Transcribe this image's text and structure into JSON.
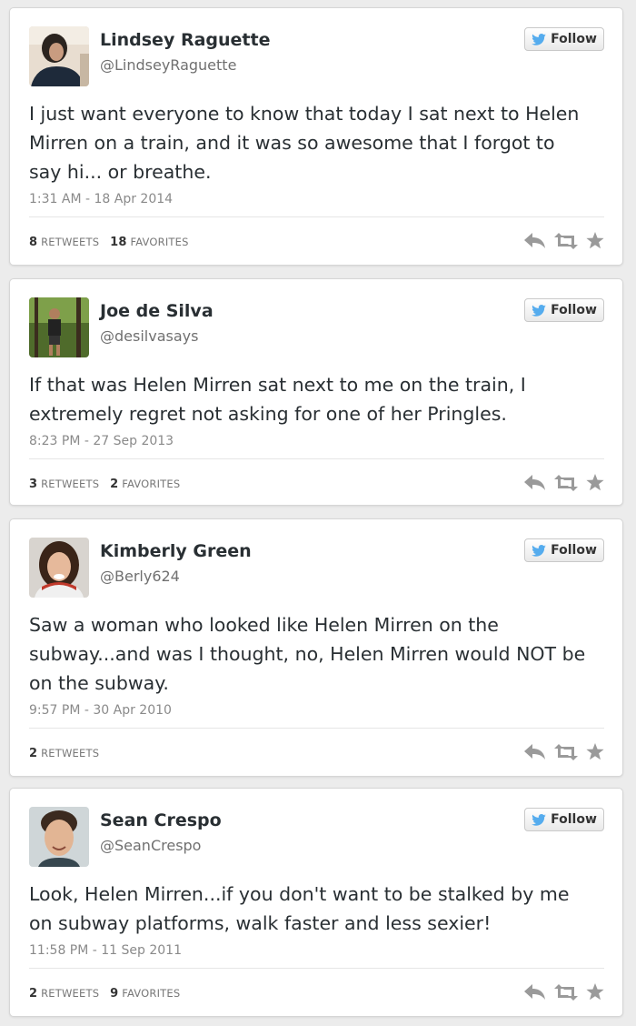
{
  "tweets": [
    {
      "name": "Lindsey Raguette",
      "handle": "@LindseyRaguette",
      "follow_label": "Follow",
      "text": "I just want everyone to know that today I sat next to Helen Mirren on a train, and it was so awesome that I forgot to say hi... or breathe.",
      "timestamp": "1:31 AM - 18 Apr 2014",
      "retweets_count": "8",
      "retweets_label": "RETWEETS",
      "favorites_count": "18",
      "favorites_label": "FAVORITES"
    },
    {
      "name": "Joe de Silva",
      "handle": "@desilvasays",
      "follow_label": "Follow",
      "text": "If that was Helen Mirren sat next to me on the train, I extremely regret not asking for one of her Pringles.",
      "timestamp": "8:23 PM - 27 Sep 2013",
      "retweets_count": "3",
      "retweets_label": "RETWEETS",
      "favorites_count": "2",
      "favorites_label": "FAVORITES"
    },
    {
      "name": "Kimberly Green",
      "handle": "@Berly624",
      "follow_label": "Follow",
      "text": "Saw a woman who looked like Helen Mirren on the subway...and was I thought, no, Helen Mirren would NOT be on the subway.",
      "timestamp": "9:57 PM - 30 Apr 2010",
      "retweets_count": "2",
      "retweets_label": "RETWEETS",
      "favorites_count": "",
      "favorites_label": ""
    },
    {
      "name": "Sean Crespo",
      "handle": "@SeanCrespo",
      "follow_label": "Follow",
      "text": "Look, Helen Mirren...if you don't want to be stalked by me on subway platforms, walk faster and less sexier!",
      "timestamp": "11:58 PM - 11 Sep 2011",
      "retweets_count": "2",
      "retweets_label": "RETWEETS",
      "favorites_count": "9",
      "favorites_label": "FAVORITES"
    }
  ],
  "icons": {
    "follow": "twitter-bird-icon",
    "reply": "reply-icon",
    "retweet": "retweet-icon",
    "favorite": "star-icon"
  },
  "colors": {
    "twitter_blue": "#55acee",
    "action_gray": "#9a9a9a"
  }
}
